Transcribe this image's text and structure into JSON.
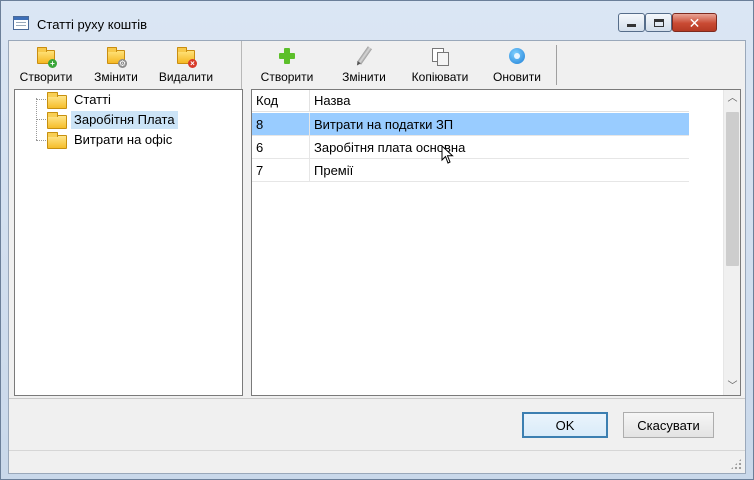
{
  "window": {
    "title": "Статті руху коштів"
  },
  "left_toolbar": {
    "create_label": "Створити",
    "edit_label": "Змінити",
    "delete_label": "Видалити"
  },
  "right_toolbar": {
    "create_label": "Створити",
    "edit_label": "Змінити",
    "copy_label": "Копіювати",
    "refresh_label": "Оновити"
  },
  "tree": {
    "items": [
      {
        "label": "Статті",
        "selected": false
      },
      {
        "label": "Заробітня Плата",
        "selected": true
      },
      {
        "label": "Витрати на офіс",
        "selected": false
      }
    ]
  },
  "grid": {
    "columns": [
      "Код",
      "Назва"
    ],
    "rows": [
      {
        "code": "8",
        "name": "Витрати на податки ЗП",
        "selected": true
      },
      {
        "code": "6",
        "name": "Заробітня плата основна",
        "selected": false
      },
      {
        "code": "7",
        "name": "Премії",
        "selected": false
      }
    ]
  },
  "buttons": {
    "ok_label": "OK",
    "cancel_label": "Скасувати"
  },
  "colors": {
    "selection": "#99ccff",
    "tree_selection": "#cce4f7",
    "close_button": "#c94a33",
    "default_button_border": "#3c7fb1"
  }
}
